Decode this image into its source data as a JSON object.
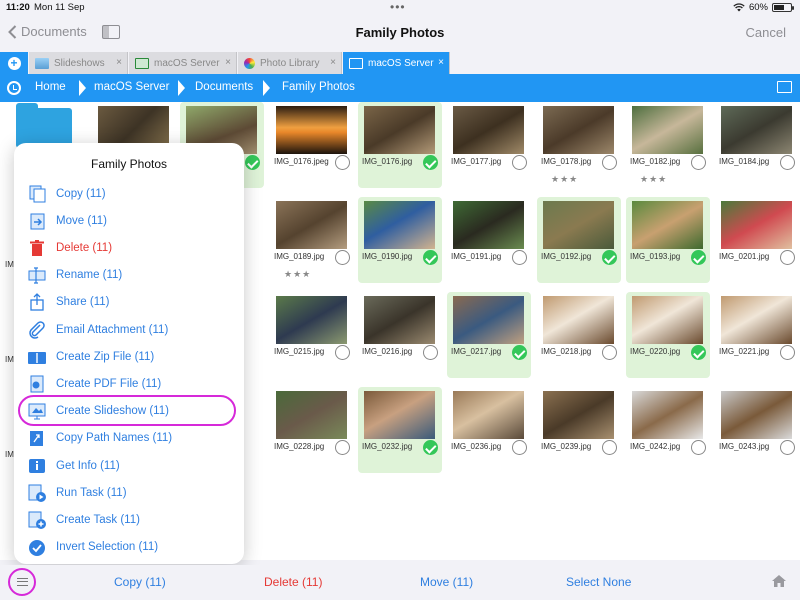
{
  "status_bar": {
    "time": "11:20",
    "date": "Mon 11 Sep",
    "battery_text": "60%",
    "battery_level": 0.6
  },
  "nav": {
    "back_label": "Documents",
    "title": "Family Photos",
    "cancel_label": "Cancel"
  },
  "tabs": [
    {
      "label": "Slideshows",
      "icon": "slideshow-icon",
      "close": "×",
      "active": false
    },
    {
      "label": "macOS Server",
      "icon": "monitor-icon",
      "close": "×",
      "active": false
    },
    {
      "label": "Photo Library",
      "icon": "photos-icon",
      "close": "×",
      "active": false
    },
    {
      "label": "macOS Server",
      "icon": "monitor-icon",
      "close": "×",
      "active": true
    }
  ],
  "breadcrumb": [
    "Home",
    "macOS Server",
    "Documents",
    "Family Photos"
  ],
  "files": [
    {
      "name": "",
      "selected": false,
      "checked": false,
      "stars": ""
    },
    {
      "name": "",
      "selected": false,
      "checked": false,
      "stars": ""
    },
    {
      "name": "",
      "selected": true,
      "checked": true,
      "stars": ""
    },
    {
      "name": "IMG_0176.jpeg",
      "selected": false,
      "checked": false,
      "stars": ""
    },
    {
      "name": "IMG_0176.jpg",
      "selected": true,
      "checked": true,
      "stars": ""
    },
    {
      "name": "IMG_0177.jpg",
      "selected": false,
      "checked": false,
      "stars": ""
    },
    {
      "name": "IMG_0178.jpg",
      "selected": false,
      "checked": false,
      "stars": "★★★"
    },
    {
      "name": "IMG_0182.jpg",
      "selected": false,
      "checked": false,
      "stars": "★★★"
    },
    {
      "name": "IMG_0184.jpg",
      "selected": false,
      "checked": false,
      "stars": ""
    },
    {
      "name": "IMG_0189.jpg",
      "selected": false,
      "checked": false,
      "stars": "★★★"
    },
    {
      "name": "IMG_0190.jpg",
      "selected": true,
      "checked": true,
      "stars": ""
    },
    {
      "name": "IMG_0191.jpg",
      "selected": false,
      "checked": false,
      "stars": ""
    },
    {
      "name": "IMG_0192.jpg",
      "selected": true,
      "checked": true,
      "stars": ""
    },
    {
      "name": "IMG_0193.jpg",
      "selected": true,
      "checked": true,
      "stars": ""
    },
    {
      "name": "IMG_0201.jpg",
      "selected": false,
      "checked": false,
      "stars": ""
    },
    {
      "name": "IMG_0215.jpg",
      "selected": false,
      "checked": false,
      "stars": ""
    },
    {
      "name": "IMG_0216.jpg",
      "selected": false,
      "checked": false,
      "stars": ""
    },
    {
      "name": "IMG_0217.jpg",
      "selected": true,
      "checked": true,
      "stars": ""
    },
    {
      "name": "IMG_0218.jpg",
      "selected": false,
      "checked": false,
      "stars": ""
    },
    {
      "name": "IMG_0220.jpg",
      "selected": true,
      "checked": true,
      "stars": ""
    },
    {
      "name": "IMG_0221.jpg",
      "selected": false,
      "checked": false,
      "stars": ""
    },
    {
      "name": "IMG_0228.jpg",
      "selected": false,
      "checked": false,
      "stars": ""
    },
    {
      "name": "IMG_0232.jpg",
      "selected": true,
      "checked": true,
      "stars": ""
    },
    {
      "name": "IMG_0236.jpg",
      "selected": false,
      "checked": false,
      "stars": ""
    },
    {
      "name": "IMG_0239.jpg",
      "selected": false,
      "checked": false,
      "stars": ""
    },
    {
      "name": "IMG_0242.jpg",
      "selected": false,
      "checked": false,
      "stars": ""
    },
    {
      "name": "IMG_0243.jpg",
      "selected": false,
      "checked": false,
      "stars": ""
    }
  ],
  "partial_labels": [
    "IM",
    "IM",
    "IM"
  ],
  "popover": {
    "title": "Family Photos",
    "items": [
      {
        "label": "Copy (11)",
        "icon": "copy-icon",
        "danger": false
      },
      {
        "label": "Move (11)",
        "icon": "move-icon",
        "danger": false
      },
      {
        "label": "Delete (11)",
        "icon": "trash-icon",
        "danger": true
      },
      {
        "label": "Rename (11)",
        "icon": "rename-icon",
        "danger": false
      },
      {
        "label": "Share (11)",
        "icon": "share-icon",
        "danger": false
      },
      {
        "label": "Email Attachment (11)",
        "icon": "paperclip-icon",
        "danger": false
      },
      {
        "label": "Create Zip File (11)",
        "icon": "zip-icon",
        "danger": false
      },
      {
        "label": "Create PDF File (11)",
        "icon": "pdf-icon",
        "danger": false
      },
      {
        "label": "Create Slideshow (11)",
        "icon": "slideshow-icon",
        "danger": false
      },
      {
        "label": "Copy Path Names (11)",
        "icon": "path-icon",
        "danger": false
      },
      {
        "label": "Get Info (11)",
        "icon": "info-icon",
        "danger": false
      },
      {
        "label": "Run Task (11)",
        "icon": "run-task-icon",
        "danger": false
      },
      {
        "label": "Create Task (11)",
        "icon": "create-task-icon",
        "danger": false
      },
      {
        "label": "Invert Selection (11)",
        "icon": "invert-selection-icon",
        "danger": false
      }
    ]
  },
  "bottom": {
    "copy": "Copy (11)",
    "delete": "Delete (11)",
    "move": "Move (11)",
    "select_none": "Select None"
  },
  "colors": {
    "accent": "#2196f3",
    "link": "#2f7fe0",
    "danger": "#e53935",
    "check": "#34c759",
    "selected_bg": "#dff3d8",
    "highlight": "#d629d9"
  }
}
